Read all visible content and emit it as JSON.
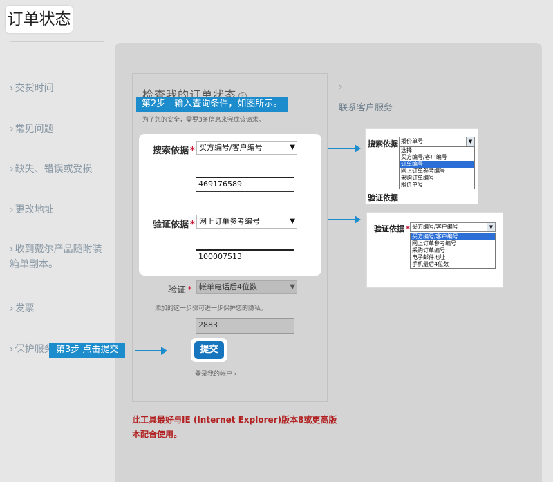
{
  "page": {
    "title": "订单状态"
  },
  "sidebar": {
    "items": [
      {
        "label": "交货时间"
      },
      {
        "label": "常见问题"
      },
      {
        "label": "缺失、错误或受损"
      },
      {
        "label": "更改地址"
      },
      {
        "label": "收到戴尔产品随附装箱单副本。"
      },
      {
        "label": "发票"
      },
      {
        "label": "保护服务"
      }
    ]
  },
  "query": {
    "title": "检查我的订单状态",
    "note": "为了您的安全，需要3条信息来完成该请求。",
    "search_label": "搜索依据",
    "search_select": "买方编号/客户编号",
    "search_value": "469176589",
    "verify_label": "验证依据",
    "verify_select": "网上订单参考编号",
    "verify_value": "100007513",
    "extra_label": "验证",
    "extra_select": "帐单电话后4位数",
    "extra_hint": "添加的这一步骤可进一步保护您的隐私。",
    "extra_value": "2883",
    "submit_label": "提交",
    "login_link": "登录我的帐户 ›"
  },
  "steps": {
    "step2": "第2步　输入查询条件，如图所示。",
    "step3": "第3步 点击提交"
  },
  "right": {
    "chevron": "›",
    "contact": "联系客户服务"
  },
  "warning": "此工具最好与IE (Internet Explorer)版本8或更高版本配合使用。",
  "inset1": {
    "label": "搜索依据",
    "selected": "报价单号",
    "options": [
      {
        "text": "选择",
        "highlight": false
      },
      {
        "text": "买方编号/客户编号",
        "highlight": false
      },
      {
        "text": "订单编号",
        "highlight": true
      },
      {
        "text": "网上订单参考编号",
        "highlight": false
      },
      {
        "text": "采购订单编号",
        "highlight": false
      },
      {
        "text": "报价单号",
        "highlight": false
      }
    ],
    "below_label": "验证依据"
  },
  "inset2": {
    "label": "验证依据",
    "selected": "买方编号/客户编号",
    "options": [
      {
        "text": "买方编号/客户编号",
        "highlight": true
      },
      {
        "text": "网上订单参考编号",
        "highlight": false
      },
      {
        "text": "采购订单编号",
        "highlight": false
      },
      {
        "text": "电子邮件地址",
        "highlight": false
      },
      {
        "text": "手机最后4位数",
        "highlight": false
      }
    ]
  },
  "colors": {
    "accent": "#1c8ccd",
    "button": "#1775bd",
    "required": "#c8102e",
    "warning": "#b22222"
  },
  "icons": {
    "help": "help-icon",
    "dropdown": "chevron-down-icon",
    "arrow": "arrow-right-icon"
  }
}
